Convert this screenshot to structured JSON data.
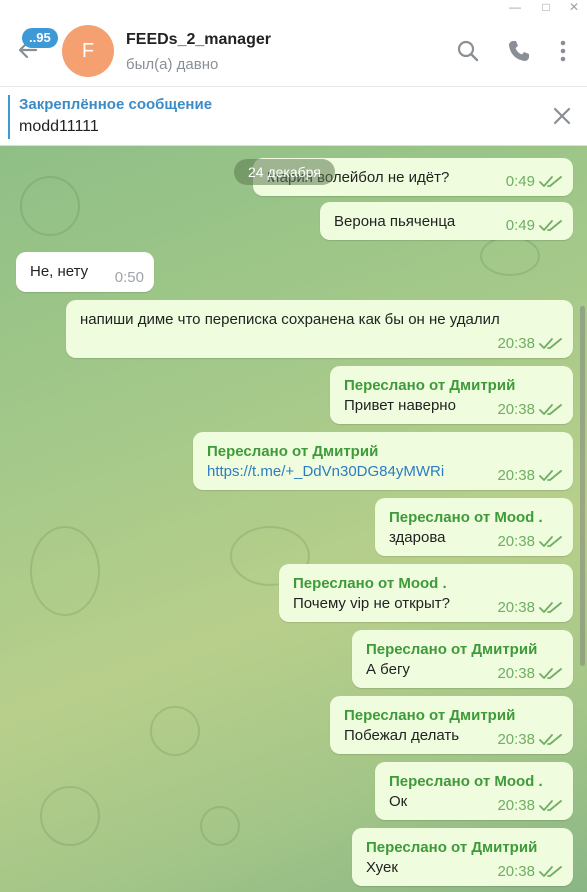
{
  "header": {
    "unread_badge": "..95",
    "avatar_letter": "F",
    "title": "FEEDs_2_manager",
    "status": "был(а) давно"
  },
  "pinned": {
    "title": "Закреплённое сообщение",
    "text": "modd11111"
  },
  "date_label": "24 декабря",
  "messages": [
    {
      "text": "Мария волейбол  не идёт?",
      "time": "0:49"
    },
    {
      "text": "Верона  пьяченца",
      "time": "0:49"
    },
    {
      "text": "Не, нету",
      "time": "0:50"
    },
    {
      "text": "напиши диме что переписка сохранена как бы он не удалил",
      "time": "20:38"
    },
    {
      "forward": "Переслано от Дмитрий",
      "text": "Привет наверно",
      "time": "20:38"
    },
    {
      "forward": "Переслано от Дмитрий",
      "text": "https://t.me/+_DdVn30DG84yMWRi",
      "time": "20:38"
    },
    {
      "forward": "Переслано от Mood .",
      "text": "здарова",
      "time": "20:38"
    },
    {
      "forward": "Переслано от Mood .",
      "text": "Почему vip  не открыт?",
      "time": "20:38"
    },
    {
      "forward": "Переслано от Дмитрий",
      "text": "А бегу",
      "time": "20:38"
    },
    {
      "forward": "Переслано от Дмитрий",
      "text": "Побежал делать",
      "time": "20:38"
    },
    {
      "forward": "Переслано от Mood .",
      "text": "Ок",
      "time": "20:38"
    },
    {
      "forward": "Переслано от Дмитрий",
      "text": "Хуек",
      "time": "20:38"
    }
  ],
  "colors": {
    "accent": "#3e9ad6",
    "outgoing_bubble": "#effdde",
    "forward_name": "#3f9a3a",
    "avatar": "#f4a070"
  }
}
